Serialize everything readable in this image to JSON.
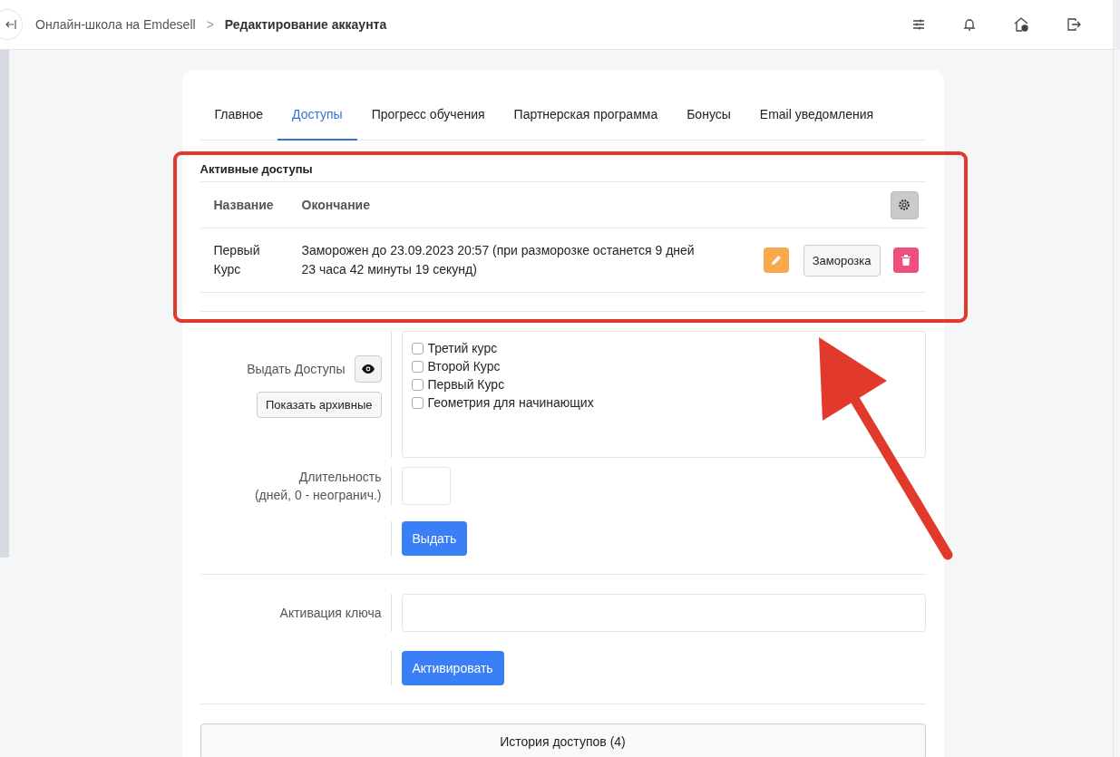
{
  "header": {
    "breadcrumbs": [
      {
        "label": "Онлайн-школа на Emdesell",
        "current": false
      },
      {
        "label": "Редактирование аккаунта",
        "current": true
      }
    ],
    "separator": ">"
  },
  "tabs": [
    {
      "label": "Главное",
      "selected": false
    },
    {
      "label": "Доступы",
      "selected": true
    },
    {
      "label": "Прогресс обучения",
      "selected": false
    },
    {
      "label": "Партнерская программа",
      "selected": false
    },
    {
      "label": "Бонусы",
      "selected": false
    },
    {
      "label": "Email уведомления",
      "selected": false
    }
  ],
  "active_access": {
    "title": "Активные доступы",
    "columns": [
      "Название",
      "Окончание"
    ],
    "rows": [
      {
        "name": "Первый Курс",
        "end": "Заморожен до 23.09.2023 20:57 (при разморозке останется 9 дней 23 часа 42 минуты 19 секунд)",
        "freeze_button": "Заморозка"
      }
    ]
  },
  "grant_form": {
    "label": "Выдать Доступы",
    "archive_button": "Показать архивные",
    "courses": [
      {
        "label": "Третий курс",
        "checked": false
      },
      {
        "label": "Второй Курс",
        "checked": false
      },
      {
        "label": "Первый Курс",
        "checked": false
      },
      {
        "label": "Геометрия для начинающих",
        "checked": false
      }
    ],
    "duration_label": "Длительность",
    "duration_hint": "(дней, 0 - неогранич.)",
    "submit_button": "Выдать"
  },
  "key_form": {
    "label": "Активация ключа",
    "submit_button": "Активировать"
  },
  "history_button": "История доступов (4)"
}
